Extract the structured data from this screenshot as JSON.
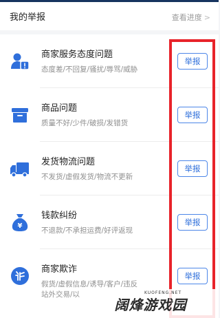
{
  "header": {
    "title": "我的举报",
    "link": "查看进度",
    "link_icon": "chevron-right-icon"
  },
  "items": [
    {
      "title": "商家服务态度问题",
      "desc": "态度差/不回复/骚扰/辱骂/威胁",
      "desc2": "",
      "button": "举报",
      "icon": "user-alert-icon"
    },
    {
      "title": "商品问题",
      "desc": "质量不好/少件/破损/发错货",
      "desc2": "",
      "button": "举报",
      "icon": "box-icon"
    },
    {
      "title": "发货物流问题",
      "desc": "不发货/虚假发货/物流不更新",
      "desc2": "",
      "button": "举报",
      "icon": "truck-icon"
    },
    {
      "title": "钱款纠纷",
      "desc": "不退款/不承担运费/好评返现",
      "desc2": "",
      "button": "举报",
      "icon": "money-bag-icon"
    },
    {
      "title": "商家欺诈",
      "desc": "假货/虚假信息/诱导/客户/违反",
      "desc2": "站外交易/以",
      "button": "举报",
      "icon": "fraud-icon"
    }
  ],
  "watermark": {
    "text": "阔烽游戏园",
    "sub": "KUOFENG.NET"
  },
  "colors": {
    "accent": "#2f6fdb",
    "icon_blue": "#2f6fdb",
    "highlight": "#e8232a",
    "topbar": "#17345f"
  }
}
